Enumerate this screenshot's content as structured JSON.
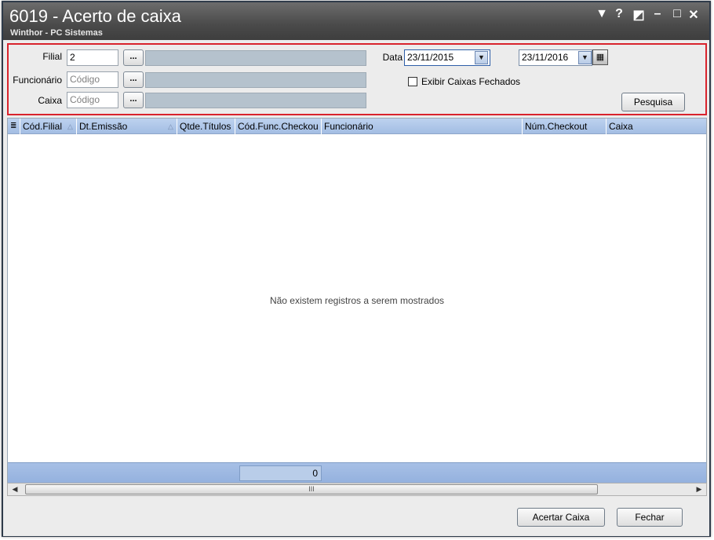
{
  "window": {
    "title": "6019 - Acerto de caixa",
    "subtitle": "Winthor - PC Sistemas",
    "controls": [
      "▼",
      "?",
      "◩",
      "–",
      "□",
      "✕"
    ]
  },
  "filters": {
    "filial_label": "Filial",
    "filial_value": "2",
    "funcionario_label": "Funcionário",
    "funcionario_placeholder": "Código",
    "caixa_label": "Caixa",
    "caixa_placeholder": "Código",
    "dots_label": "...",
    "data_label": "Data",
    "data_inicio": "23/11/2015",
    "data_fim": "23/11/2016",
    "exibir_fechados_label": "Exibir Caixas Fechados",
    "exibir_fechados_checked": false,
    "pesquisa_button": "Pesquisa"
  },
  "grid": {
    "columns": [
      "Cód.Filial",
      "Dt.Emissão",
      "Qtde.Títulos",
      "Cód.Func.Checkou",
      "Funcionário",
      "Núm.Checkout",
      "Caixa"
    ],
    "empty_message": "Não existem registros a serem mostrados",
    "total_value": "0"
  },
  "scrollbar": {
    "thumb_grip": "III"
  },
  "actions": {
    "acertar_caixa": "Acertar Caixa",
    "fechar": "Fechar"
  },
  "colors": {
    "title_bar": "#4a4a4a",
    "panel_border": "#d9232d",
    "grid_header": "#a3bde3",
    "description_bar": "#b5c2cd"
  }
}
